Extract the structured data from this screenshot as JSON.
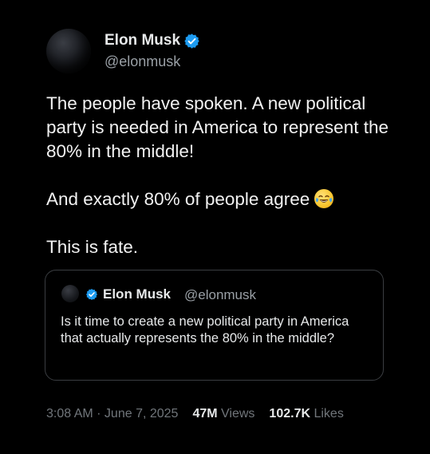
{
  "tweet": {
    "author_name": "Elon Musk",
    "handle": "@elonmusk",
    "text_lines": [
      "The people have spoken. A new political party is needed in America to represent the 80% in the middle!",
      "And exactly 80% of people agree",
      "This is fate."
    ],
    "emoji_icon": "face-with-tears-of-joy-icon",
    "timestamp": "3:08 AM · June 7, 2025",
    "views_count": "47M",
    "views_label": "Views",
    "likes_count": "102.7K",
    "likes_label": "Likes"
  },
  "quoted_tweet": {
    "author_name": "Elon Musk",
    "handle": "@elonmusk",
    "text": "Is it time to create a new political party in America that actually represents the 80% in the middle?"
  },
  "colors": {
    "background": "#000000",
    "verified_badge": "#1d9bf0",
    "primary_text": "#e7e9ea",
    "secondary_text": "#71767b",
    "quote_border": "#3a3d41"
  }
}
